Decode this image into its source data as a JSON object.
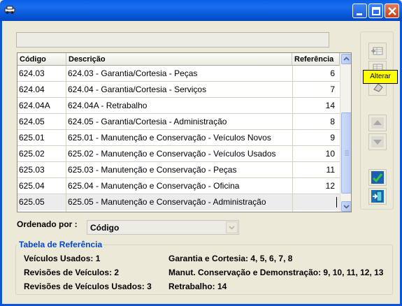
{
  "window": {
    "icon": "car-icon",
    "controls": [
      "minimize-icon",
      "maximize-icon",
      "close-icon"
    ]
  },
  "search": {
    "value": ""
  },
  "table": {
    "columns": [
      "Código",
      "Descrição",
      "Referência"
    ],
    "rows": [
      {
        "code": "624.03",
        "desc": "624.03 - Garantia/Cortesia - Peças",
        "ref": "6"
      },
      {
        "code": "624.04",
        "desc": "624.04 - Garantia/Cortesia - Serviços",
        "ref": "7"
      },
      {
        "code": "624.04A",
        "desc": "624.04A - Retrabalho",
        "ref": "14"
      },
      {
        "code": "624.05",
        "desc": "624.05 - Garantia/Cortesia - Administração",
        "ref": "8"
      },
      {
        "code": "625.01",
        "desc": "625.01 - Manutenção e Conservação - Veículos Novos",
        "ref": "9"
      },
      {
        "code": "625.02",
        "desc": "625.02 - Manutenção e Conservação - Veículos Usados",
        "ref": "10"
      },
      {
        "code": "625.03",
        "desc": "625.03 - Manutenção e Conservação - Peças",
        "ref": "11"
      },
      {
        "code": "625.04",
        "desc": "625.04 - Manutenção e Conservação - Oficina",
        "ref": "12"
      },
      {
        "code": "625.05",
        "desc": "625.05 - Manutenção e Conservação - Administração",
        "ref": ""
      }
    ]
  },
  "toolbar": {
    "tooltip": "Alterar",
    "buttons": [
      "add-record-icon",
      "edit-record-icon",
      "delete-record-icon",
      "move-up-icon",
      "move-down-icon",
      "confirm-icon",
      "exit-icon"
    ]
  },
  "order": {
    "label": "Ordenado por :",
    "value": "Código"
  },
  "reference": {
    "title": "Tabela de Referência",
    "left": [
      "Veículos Usados: 1",
      "Revisões de Veículos: 2",
      "Revisões de Veículos Usados: 3"
    ],
    "right": [
      "Garantia e Cortesia:  4, 5, 6, 7, 8",
      "Manut. Conservação e Demonstração: 9, 10, 11, 12, 13",
      "Retrabalho: 14"
    ]
  },
  "colors": {
    "titlebar": "#0a5ee6",
    "accent": "#0046d5",
    "tooltip": "#ffff00"
  }
}
